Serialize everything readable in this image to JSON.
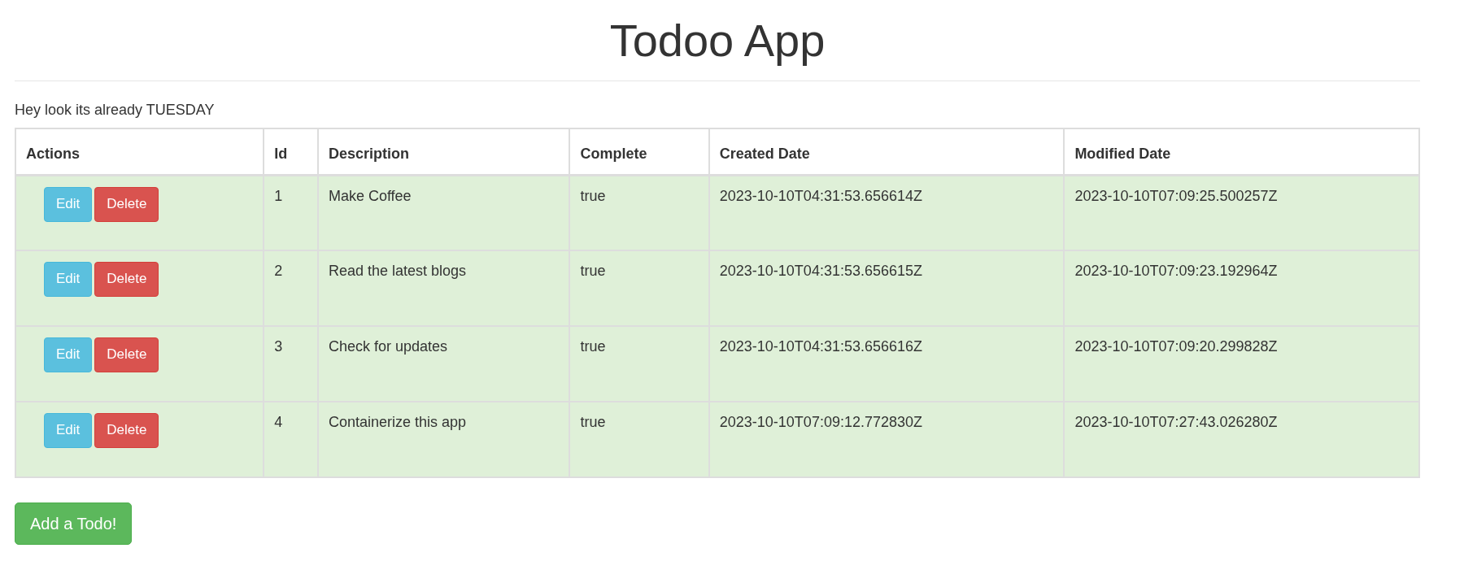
{
  "title": "Todoo App",
  "message": "Hey look its already TUESDAY",
  "table": {
    "columns": [
      "Actions",
      "Id",
      "Description",
      "Complete",
      "Created Date",
      "Modified Date"
    ],
    "rows": [
      {
        "id": "1",
        "description": "Make Coffee",
        "complete": "true",
        "created": "2023-10-10T04:31:53.656614Z",
        "modified": "2023-10-10T07:09:25.500257Z",
        "actions": [
          "Edit",
          "Delete"
        ]
      },
      {
        "id": "2",
        "description": "Read the latest blogs",
        "complete": "true",
        "created": "2023-10-10T04:31:53.656615Z",
        "modified": "2023-10-10T07:09:23.192964Z",
        "actions": [
          "Edit",
          "Delete"
        ]
      },
      {
        "id": "3",
        "description": "Check for updates",
        "complete": "true",
        "created": "2023-10-10T04:31:53.656616Z",
        "modified": "2023-10-10T07:09:20.299828Z",
        "actions": [
          "Edit",
          "Delete"
        ]
      },
      {
        "id": "4",
        "description": "Containerize this app",
        "complete": "true",
        "created": "2023-10-10T07:09:12.772830Z",
        "modified": "2023-10-10T07:27:43.026280Z",
        "actions": [
          "Edit",
          "Delete"
        ]
      }
    ]
  },
  "add_button": "Add a Todo!"
}
